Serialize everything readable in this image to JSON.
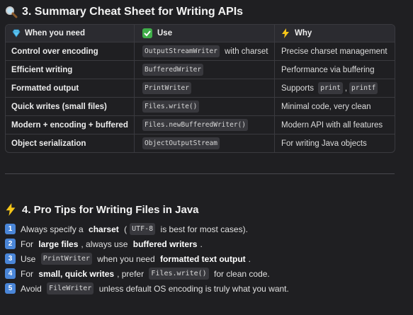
{
  "section3": {
    "title": "3. Summary Cheat Sheet for Writing APIs",
    "icon": "magnifier-icon"
  },
  "table": {
    "headers": [
      {
        "icon": "gem-icon",
        "label": "When you need"
      },
      {
        "icon": "check-mark-icon",
        "label": "Use"
      },
      {
        "icon": "lightning-icon",
        "label": "Why"
      }
    ],
    "rows": [
      {
        "need": "Control over encoding",
        "use_code": "OutputStreamWriter",
        "use_suffix": " with charset",
        "why": "Precise charset management"
      },
      {
        "need": "Efficient writing",
        "use_code": "BufferedWriter",
        "use_suffix": "",
        "why": "Performance via buffering"
      },
      {
        "need": "Formatted output",
        "use_code": "PrintWriter",
        "use_suffix": "",
        "why_prefix": "Supports ",
        "why_code1": "print",
        "why_sep": ",",
        "why_code2": "printf"
      },
      {
        "need": "Quick writes (small files)",
        "use_code": "Files.write()",
        "use_suffix": "",
        "why": "Minimal code, very clean"
      },
      {
        "need": "Modern + encoding + buffered",
        "use_code": "Files.newBufferedWriter()",
        "use_suffix": "",
        "why": "Modern API with all features"
      },
      {
        "need": "Object serialization",
        "use_code": "ObjectOutputStream",
        "use_suffix": "",
        "why": "For writing Java objects"
      }
    ]
  },
  "section4": {
    "title": "4. Pro Tips for Writing Files in Java",
    "icon": "lightning-icon"
  },
  "tips": [
    {
      "num": "1",
      "parts": [
        "Always specify a ",
        "charset",
        " (",
        "UTF-8",
        " is best for most cases)."
      ]
    },
    {
      "num": "2",
      "parts": [
        "For ",
        "large files",
        ", always use ",
        "buffered writers",
        "."
      ]
    },
    {
      "num": "3",
      "parts": [
        "Use ",
        "PrintWriter",
        " when you need ",
        "formatted text output",
        "."
      ]
    },
    {
      "num": "4",
      "parts": [
        "For ",
        "small, quick writes",
        ", prefer ",
        "Files.write()",
        " for clean code."
      ]
    },
    {
      "num": "5",
      "parts": [
        "Avoid ",
        "FileWriter",
        " unless default OS encoding is truly what you want."
      ]
    }
  ],
  "colors": {
    "background": "#1f1f22",
    "keycap": "#4a86d8",
    "check": "#3fae49",
    "lightning": "#f5c518",
    "gem": "#5fc6f2"
  }
}
